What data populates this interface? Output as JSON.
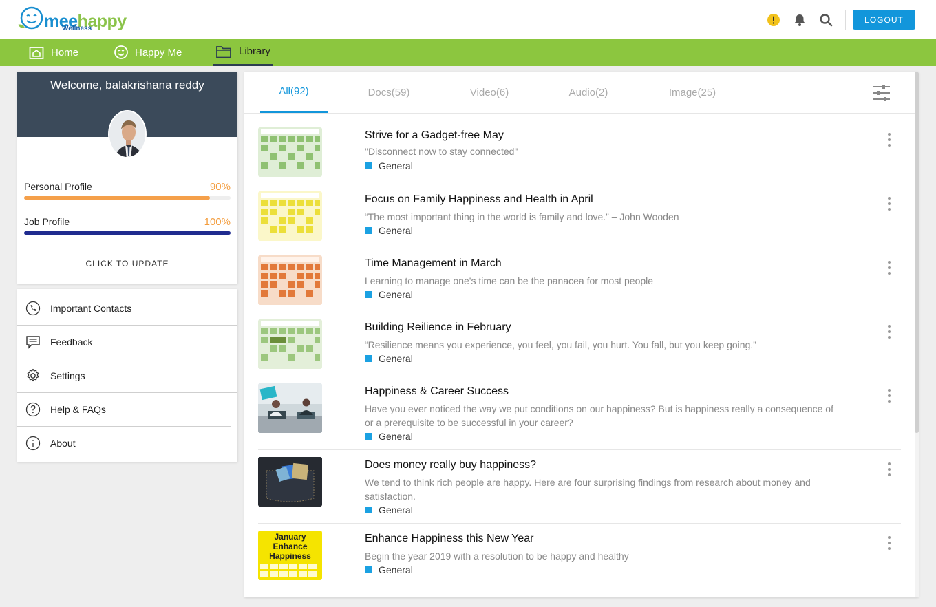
{
  "header": {
    "logo": {
      "main": "mee",
      "accent": "happy",
      "sub": "Wellness"
    },
    "logout_label": "LOGOUT",
    "icons": [
      "alert-icon",
      "bell-icon",
      "search-icon"
    ]
  },
  "nav": {
    "items": [
      {
        "label": "Home",
        "icon": "home-icon"
      },
      {
        "label": "Happy Me",
        "icon": "smiley-icon"
      },
      {
        "label": "Library",
        "icon": "folder-icon"
      }
    ],
    "active": "Library"
  },
  "profile": {
    "welcome": "Welcome, balakrishana reddy",
    "personal_label": "Personal Profile",
    "personal_pct": "90%",
    "personal_value": 0.9,
    "job_label": "Job Profile",
    "job_pct": "100%",
    "job_value": 1.0,
    "update_label": "CLICK TO UPDATE"
  },
  "menu": {
    "items": [
      {
        "label": "Important Contacts",
        "icon": "phone-icon"
      },
      {
        "label": "Feedback",
        "icon": "chat-icon"
      },
      {
        "label": "Settings",
        "icon": "gear-icon"
      },
      {
        "label": "Help & FAQs",
        "icon": "question-icon"
      },
      {
        "label": "About",
        "icon": "info-icon"
      }
    ]
  },
  "library": {
    "tabs": [
      {
        "label": "All(92)"
      },
      {
        "label": "Docs(59)"
      },
      {
        "label": "Video(6)"
      },
      {
        "label": "Audio(2)"
      },
      {
        "label": "Image(25)"
      }
    ],
    "active_tab": "All(92)",
    "items": [
      {
        "title": "Strive for a Gadget-free May",
        "desc": "\"Disconnect now to stay connected\"",
        "category": "General",
        "thumb": "green-calendar"
      },
      {
        "title": "Focus on Family Happiness and Health in April",
        "desc": "“The most important thing in the world is family and love.” – John Wooden",
        "category": "General",
        "thumb": "yellow-calendar"
      },
      {
        "title": "Time Management in March",
        "desc": "Learning to manage one's time can be the panacea for most people",
        "category": "General",
        "thumb": "orange-calendar"
      },
      {
        "title": "Building Reilience in February",
        "desc": "“Resilience means you experience, you feel, you fail, you hurt. You fall, but you keep going.”",
        "category": "General",
        "thumb": "green-calendar"
      },
      {
        "title": "Happiness & Career Success",
        "desc": "Have you ever noticed the way we put conditions on our happiness? But is happiness really a consequence of or a prerequisite to be successful in your career?",
        "category": "General",
        "thumb": "office-photo"
      },
      {
        "title": "Does money really buy happiness?",
        "desc": "We tend to think rich people are happy. Here are four surprising findings from research about money and satisfaction.",
        "category": "General",
        "thumb": "jeans-pocket-photo"
      },
      {
        "title": "Enhance Happiness this New Year",
        "desc": "Begin the year 2019 with a resolution to be happy and healthy",
        "category": "General",
        "thumb": "january-poster",
        "thumb_text": [
          "January",
          "Enhance",
          "Happiness"
        ]
      }
    ]
  },
  "colors": {
    "nav_green": "#8cc63f",
    "accent_blue": "#1296db",
    "profile_header": "#3b4a5a",
    "personal_bar": "#f5a04a",
    "job_bar": "#1f2b8f",
    "category_square": "#1ba1e2"
  }
}
